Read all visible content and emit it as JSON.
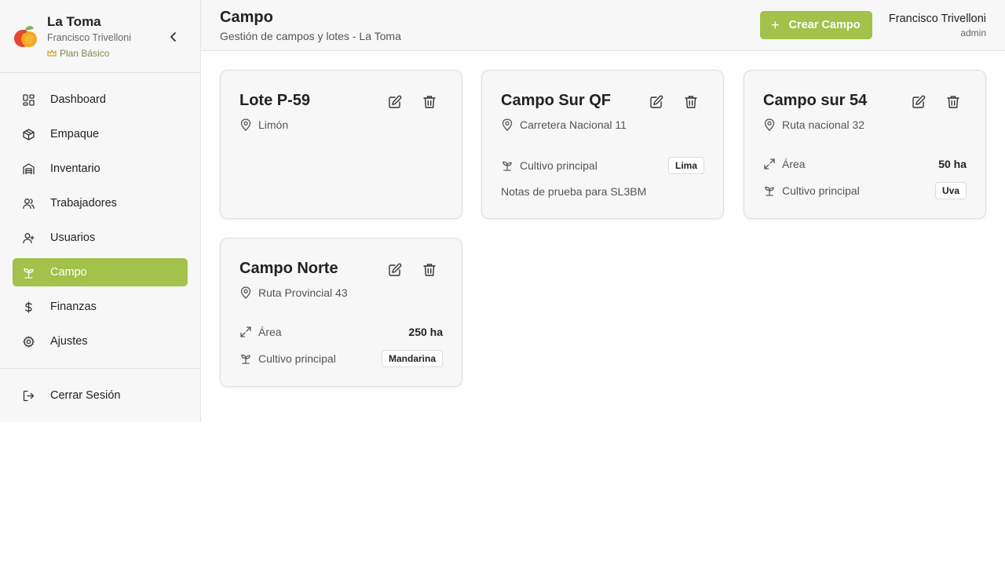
{
  "brand": {
    "name": "La Toma",
    "user": "Francisco Trivelloni",
    "plan": "Plan Básico"
  },
  "nav": {
    "items": [
      {
        "label": "Dashboard",
        "icon": "dashboard-icon"
      },
      {
        "label": "Empaque",
        "icon": "package-icon"
      },
      {
        "label": "Inventario",
        "icon": "warehouse-icon"
      },
      {
        "label": "Trabajadores",
        "icon": "users-icon"
      },
      {
        "label": "Usuarios",
        "icon": "user-plus-icon"
      },
      {
        "label": "Campo",
        "icon": "sprout-icon",
        "active": true
      },
      {
        "label": "Finanzas",
        "icon": "dollar-icon"
      },
      {
        "label": "Ajustes",
        "icon": "gear-icon"
      }
    ],
    "logout": "Cerrar Sesión"
  },
  "header": {
    "title": "Campo",
    "subtitle": "Gestión de campos y lotes - La Toma",
    "create_label": "Crear Campo",
    "user_name": "Francisco Trivelloni",
    "user_role": "admin"
  },
  "cards": [
    {
      "title": "Lote P-59",
      "location": "Limón"
    },
    {
      "title": "Campo Sur QF",
      "location": "Carretera Nacional 11",
      "crop_label": "Cultivo principal",
      "crop": "Lima",
      "notes": "Notas de prueba para SL3BM"
    },
    {
      "title": "Campo sur 54",
      "location": "Ruta nacional 32",
      "area_label": "Área",
      "area": "50 ha",
      "crop_label": "Cultivo principal",
      "crop": "Uva"
    },
    {
      "title": "Campo Norte",
      "location": "Ruta Provincial 43",
      "area_label": "Área",
      "area": "250 ha",
      "crop_label": "Cultivo principal",
      "crop": "Mandarina"
    }
  ],
  "colors": {
    "accent": "#a3c14b",
    "panel": "#f7f7f7",
    "border": "#e3e3e3"
  }
}
